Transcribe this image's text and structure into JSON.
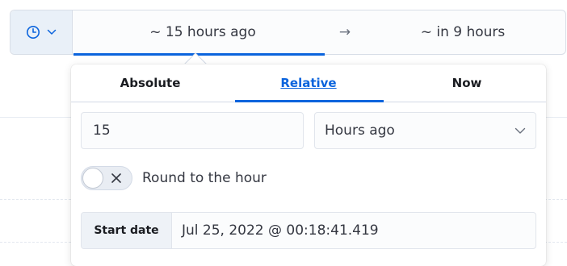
{
  "date_picker": {
    "quick_menu_icon": "clock-icon",
    "quick_menu_chevron": "chevron-down-icon",
    "start_label": "~ 15 hours ago",
    "arrow": "→",
    "end_label": "~ in 9 hours"
  },
  "popover": {
    "tabs": [
      {
        "label": "Absolute",
        "active": false
      },
      {
        "label": "Relative",
        "active": true
      },
      {
        "label": "Now",
        "active": false
      }
    ],
    "relative": {
      "value": "15",
      "unit": "Hours ago",
      "round_toggle": {
        "label": "Round to the hour",
        "checked": false
      }
    },
    "start_date": {
      "label": "Start date",
      "value": "Jul 25, 2022 @ 00:18:41.419"
    }
  },
  "colors": {
    "accent": "#0b64dd",
    "quick_menu_bg": "#e9f0f8"
  }
}
